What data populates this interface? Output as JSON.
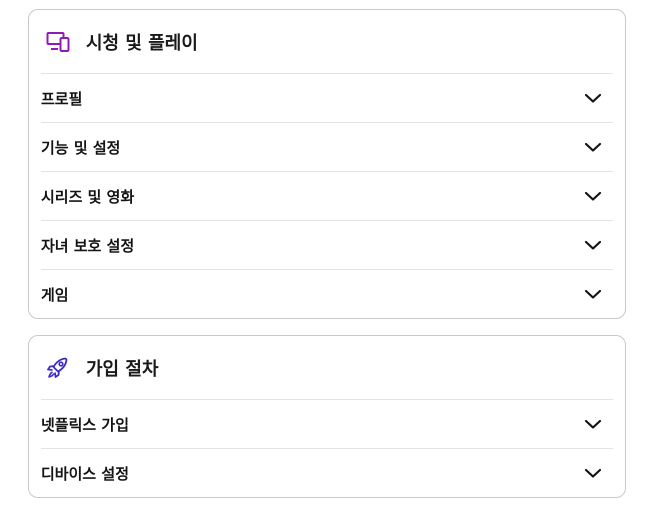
{
  "sections": [
    {
      "title": "시청 및 플레이",
      "icon": "devices-icon",
      "icon_color": "#8e1bb5",
      "items": [
        {
          "label": "프로필"
        },
        {
          "label": "기능 및 설정"
        },
        {
          "label": "시리즈 및 영화"
        },
        {
          "label": "자녀 보호 설정"
        },
        {
          "label": "게임"
        }
      ]
    },
    {
      "title": "가입 절차",
      "icon": "rocket-icon",
      "icon_color": "#3d2dc7",
      "items": [
        {
          "label": "넷플릭스 가입"
        },
        {
          "label": "디바이스 설정"
        }
      ]
    }
  ],
  "colors": {
    "border": "#c9c9c9",
    "divider": "#e3e3e3",
    "text": "#141414"
  }
}
